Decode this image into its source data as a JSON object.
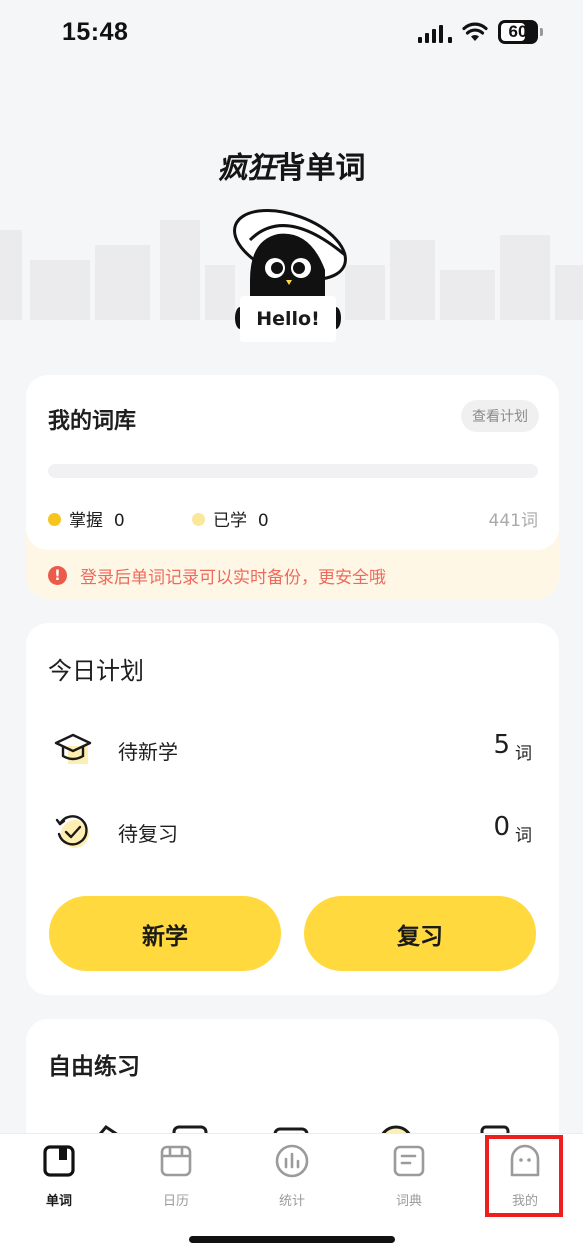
{
  "status_bar": {
    "time": "15:48",
    "battery": "60"
  },
  "header": {
    "title_stylized": "疯狂",
    "title_rest": "背单词",
    "mascot_sign": "Hello!"
  },
  "library": {
    "title": "我的词库",
    "plan_button": "查看计划",
    "mastered_label": "掌握",
    "mastered_value": "0",
    "learned_label": "已学",
    "learned_value": "0",
    "total": "441词",
    "progress": 0,
    "warning": "登录后单词记录可以实时备份，更安全哦"
  },
  "today_plan": {
    "title": "今日计划",
    "rows": [
      {
        "label": "待新学",
        "value": "5",
        "unit": "词",
        "icon": "graduation-cap-icon"
      },
      {
        "label": "待复习",
        "value": "0",
        "unit": "词",
        "icon": "review-clock-icon"
      }
    ],
    "learn_button": "新学",
    "review_button": "复习"
  },
  "free_practice": {
    "title": "自由练习"
  },
  "tabs": [
    {
      "label": "单词",
      "icon": "book-icon",
      "active": true
    },
    {
      "label": "日历",
      "icon": "calendar-icon",
      "active": false
    },
    {
      "label": "统计",
      "icon": "stats-icon",
      "active": false
    },
    {
      "label": "词典",
      "icon": "dictionary-icon",
      "active": false
    },
    {
      "label": "我的",
      "icon": "profile-ghost-icon",
      "active": false
    }
  ],
  "colors": {
    "accent": "#ffd93d",
    "warning": "#ec5b4a",
    "mastered_dot": "#f7c51e",
    "learned_dot": "#fbe79a",
    "highlight": "#ee1e1e"
  }
}
